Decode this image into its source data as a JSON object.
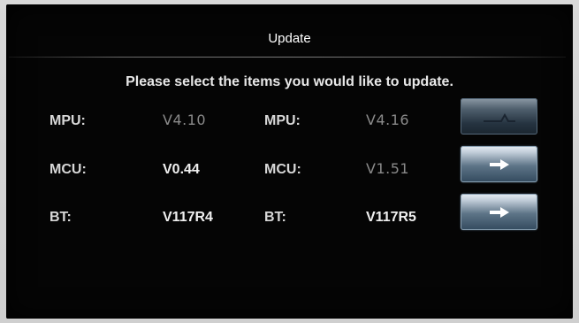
{
  "screen": {
    "title": "Update",
    "instruction": "Please select the items you would like to update."
  },
  "rows": [
    {
      "current_label": "MPU:",
      "current_version": "V4.10",
      "new_label": "MPU:",
      "new_version": "V4.16",
      "button_enabled": false
    },
    {
      "current_label": "MCU:",
      "current_version": "V0.44",
      "new_label": "MCU:",
      "new_version": "V1.51",
      "button_enabled": true
    },
    {
      "current_label": "BT:",
      "current_version": "V117R4",
      "new_label": "BT:",
      "new_version": "V117R5",
      "button_enabled": true
    }
  ],
  "icons": {
    "update_arrow": "right-arrow-icon"
  },
  "colors": {
    "background": "#050505",
    "text_primary": "#f0f0f0",
    "text_dim": "#8a8a8a",
    "button_top": "#e7eef4",
    "button_bottom": "#334a5e"
  }
}
